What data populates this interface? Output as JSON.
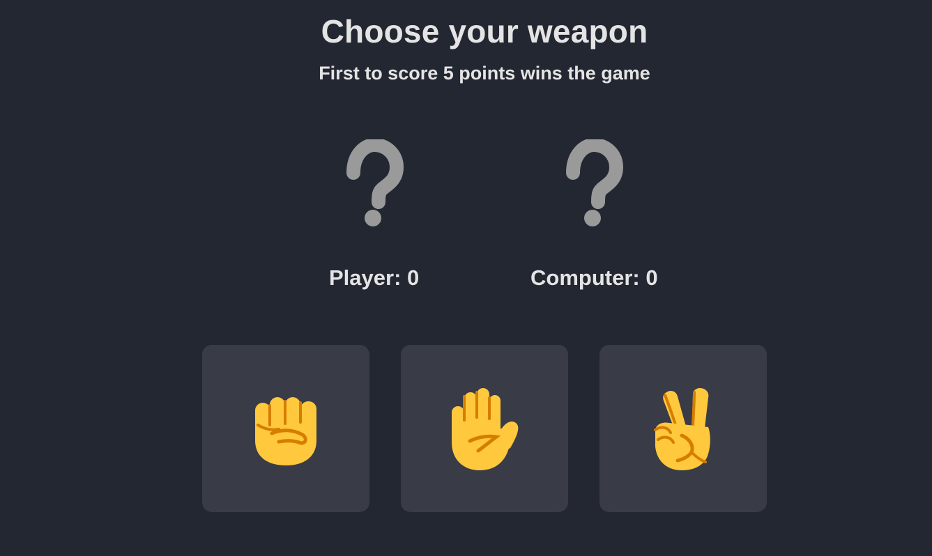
{
  "header": {
    "title": "Choose your weapon",
    "subtitle": "First to score 5 points wins the game"
  },
  "choices": {
    "player": {
      "icon": "question-mark-icon",
      "color": "#9a9a9a"
    },
    "computer": {
      "icon": "question-mark-icon",
      "color": "#9a9a9a"
    }
  },
  "scores": {
    "player": "Player: 0",
    "computer": "Computer: 0"
  },
  "weapons": [
    {
      "name": "rock",
      "icon": "raised-fist-icon"
    },
    {
      "name": "paper",
      "icon": "raised-hand-icon"
    },
    {
      "name": "scissors",
      "icon": "victory-hand-icon"
    }
  ],
  "colors": {
    "background": "#232732",
    "button": "#393c46",
    "text": "#e4e4e4",
    "emoji_skin": "#ffc83d",
    "emoji_shade": "#d67d00"
  }
}
